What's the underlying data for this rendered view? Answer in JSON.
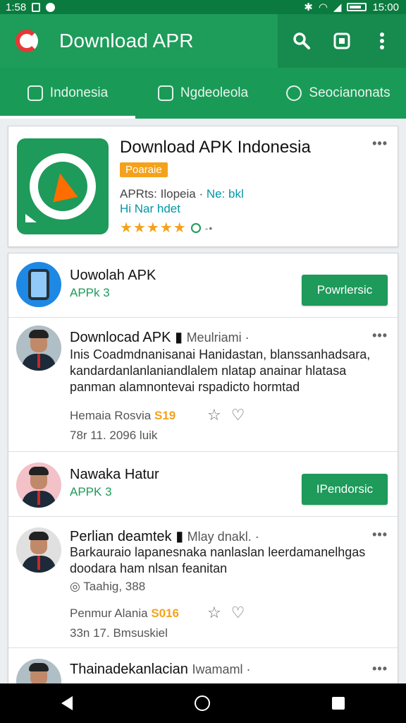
{
  "statusbar": {
    "time_left": "1:58",
    "time_right": "15:00"
  },
  "appbar": {
    "title": "Download APR"
  },
  "tabs": [
    {
      "label": "Indonesia"
    },
    {
      "label": "Ngdeoleola"
    },
    {
      "label": "Seocianonats"
    }
  ],
  "featured": {
    "title": "Download APK Indonesia",
    "badge": "Poaraie",
    "meta_line": "APRts: Ilopeia ·",
    "meta_link": "Ne: bkl",
    "meta_line2": "Hi Nar hdet",
    "rating": "★★★★★",
    "rating_suffix": "-•",
    "more": "•••"
  },
  "list": {
    "app1": {
      "title": "Uowolah APK",
      "sub": "APPk 3",
      "button": "Powrlersic"
    },
    "post1": {
      "title": "Downlocad APK",
      "title_extra": "Meulriami ·",
      "body": "Inis Coadmdnanisanai Hanidastan, blanssanhadsara, kandardanlanlaniandlalem nlatap anainar hlatasa panman alamnontevai rspadicto hormtad",
      "meta_prefix": "Hemaia Rosvia",
      "meta_value": "S19",
      "date": "78r   11. 2096 luik",
      "more": "•••"
    },
    "app2": {
      "title": "Nawaka Hatur",
      "sub": "APPK 3",
      "button": "IPendorsic"
    },
    "post2": {
      "title": "Perlian deamtek",
      "title_extra": "Mlay dnakl. ·",
      "body": "Barkauraio lapanesnaka nanlaslan leerdamanelhgas doodara ham nlsan feanitan",
      "stats": "Taahig, 388",
      "meta_prefix": "Penmur Alania",
      "meta_value": "S016",
      "date": "33n   17. Bmsuskiel",
      "more": "•••"
    },
    "post3": {
      "title": "Thainadekanlacian",
      "title_extra": "Iwamaml ·",
      "more": "•••"
    }
  },
  "colors": {
    "primary": "#1e9c5a",
    "accent": "#f4a21b",
    "link": "#0097a7"
  }
}
